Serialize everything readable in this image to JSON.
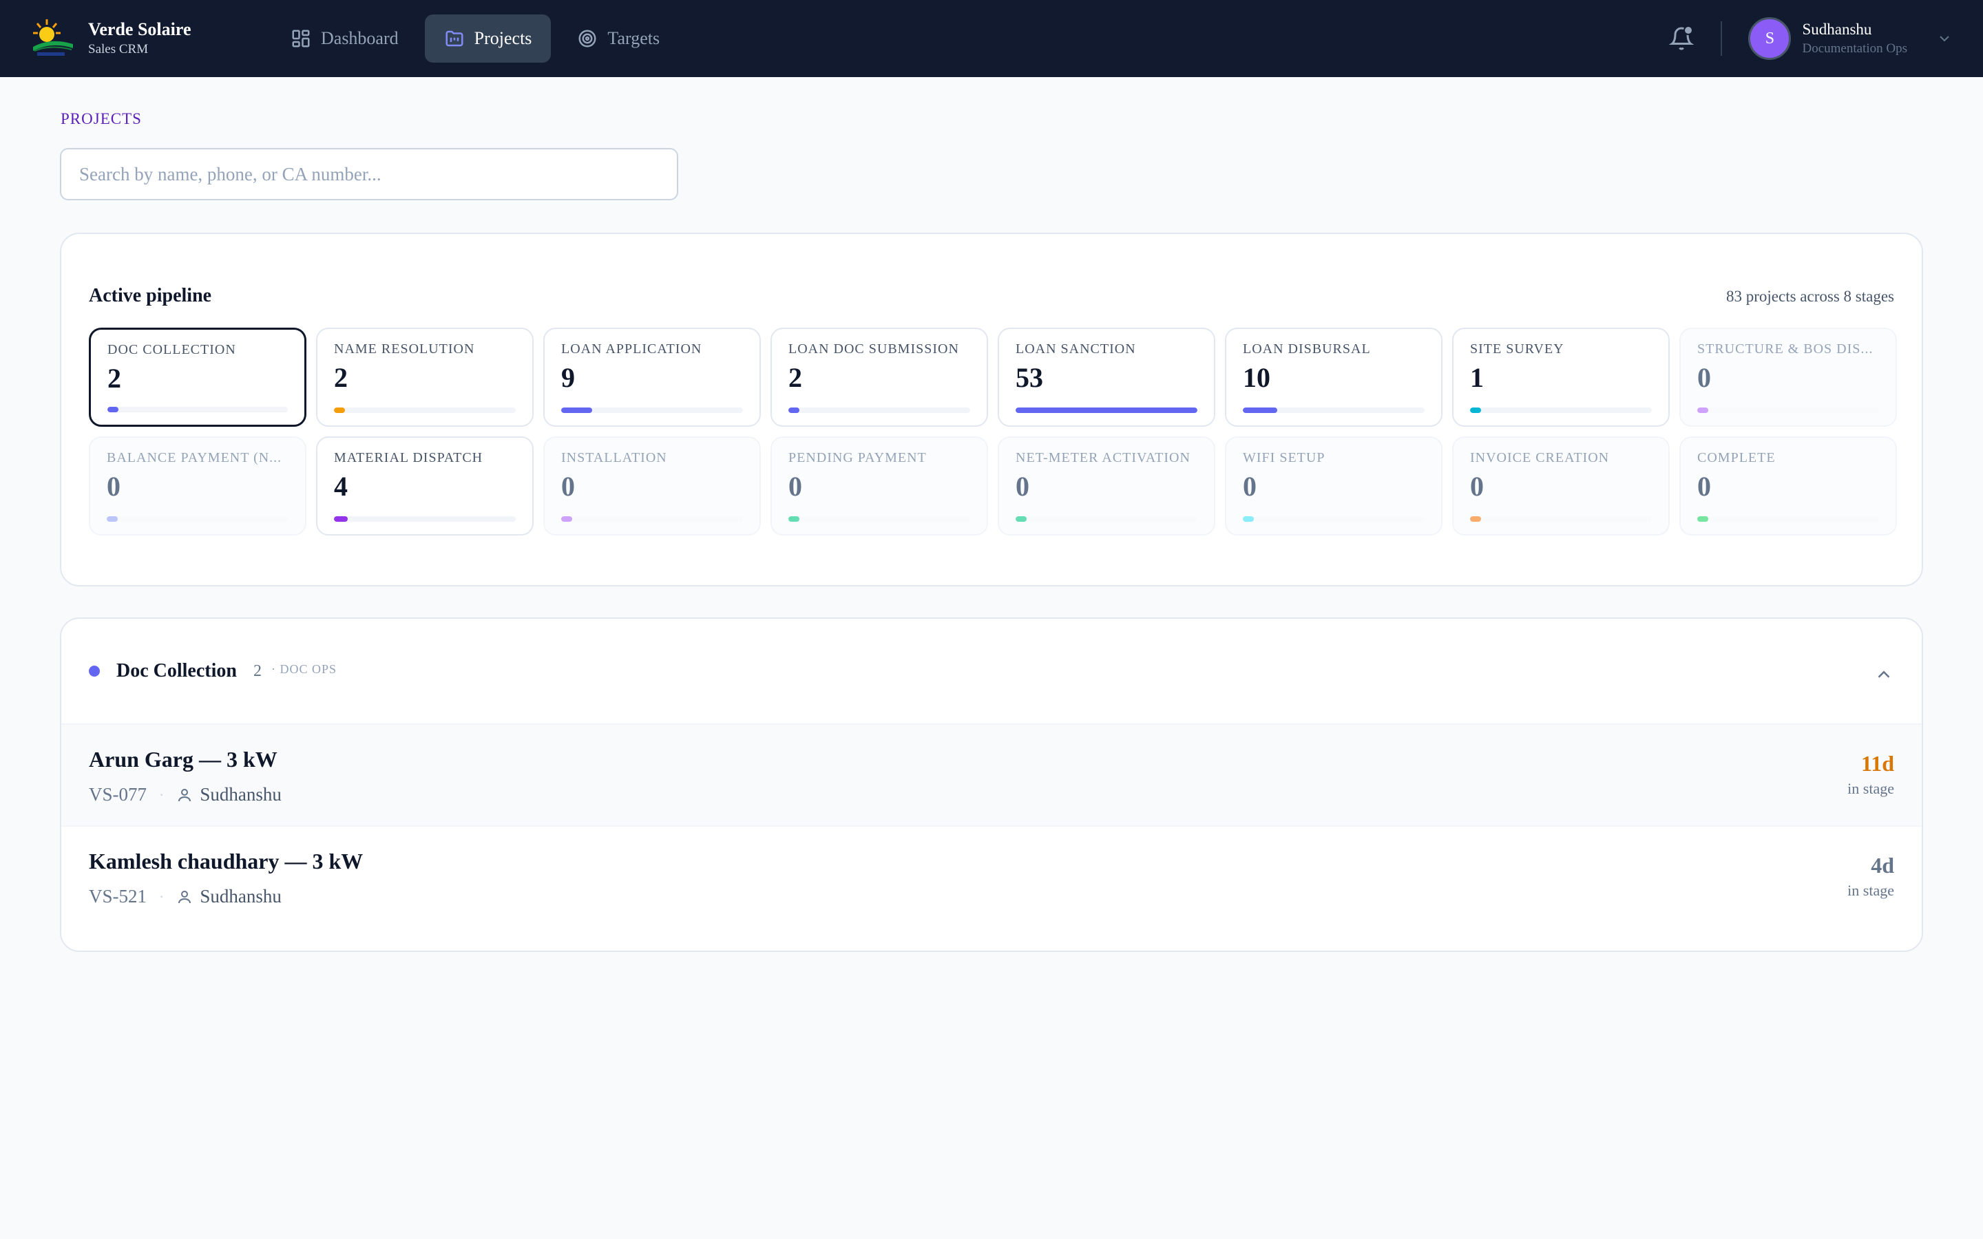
{
  "app": {
    "name": "Verde Solaire",
    "subtitle": "Sales CRM"
  },
  "nav": [
    {
      "label": "Dashboard",
      "icon": "dashboard-grid-icon",
      "active": false
    },
    {
      "label": "Projects",
      "icon": "folder-kanban-icon",
      "active": true
    },
    {
      "label": "Targets",
      "icon": "target-icon",
      "active": false
    }
  ],
  "user": {
    "name": "Sudhanshu",
    "role": "Documentation Ops",
    "initial": "S",
    "avatar_color": "#8b5cf6"
  },
  "page": {
    "label": "PROJECTS"
  },
  "search": {
    "placeholder": "Search by name, phone, or CA number...",
    "value": ""
  },
  "pipeline": {
    "title": "Active pipeline",
    "summary": "83 projects across 8 stages",
    "max_count": 53,
    "stages": [
      {
        "label": "DOC COLLECTION",
        "count": 2,
        "color": "#6366f1",
        "selected": true
      },
      {
        "label": "NAME RESOLUTION",
        "count": 2,
        "color": "#f59e0b",
        "selected": false
      },
      {
        "label": "LOAN APPLICATION",
        "count": 9,
        "color": "#6366f1",
        "selected": false
      },
      {
        "label": "LOAN DOC SUBMISSION",
        "count": 2,
        "color": "#6366f1",
        "selected": false
      },
      {
        "label": "LOAN SANCTION",
        "count": 53,
        "color": "#6366f1",
        "selected": false
      },
      {
        "label": "LOAN DISBURSAL",
        "count": 10,
        "color": "#6366f1",
        "selected": false
      },
      {
        "label": "SITE SURVEY",
        "count": 1,
        "color": "#06b6d4",
        "selected": false
      },
      {
        "label": "STRUCTURE & BOS DIS...",
        "count": 0,
        "color": "#c084fc",
        "selected": false
      },
      {
        "label": "BALANCE PAYMENT (N...",
        "count": 0,
        "color": "#a5b4fc",
        "selected": false
      },
      {
        "label": "MATERIAL DISPATCH",
        "count": 4,
        "color": "#9333ea",
        "selected": false
      },
      {
        "label": "INSTALLATION",
        "count": 0,
        "color": "#c084fc",
        "selected": false
      },
      {
        "label": "PENDING PAYMENT",
        "count": 0,
        "color": "#34d399",
        "selected": false
      },
      {
        "label": "NET-METER ACTIVATION",
        "count": 0,
        "color": "#34d399",
        "selected": false
      },
      {
        "label": "WIFI SETUP",
        "count": 0,
        "color": "#67e8f9",
        "selected": false
      },
      {
        "label": "INVOICE CREATION",
        "count": 0,
        "color": "#fb923c",
        "selected": false
      },
      {
        "label": "COMPLETE",
        "count": 0,
        "color": "#4ade80",
        "selected": false
      }
    ]
  },
  "group": {
    "title": "Doc Collection",
    "count": "2",
    "tag": "· DOC OPS",
    "dot_color": "#6366f1",
    "rows": [
      {
        "title": "Arun Garg — 3 kW",
        "id": "VS-077",
        "owner": "Sudhanshu",
        "days": "11d",
        "days_label": "in stage",
        "status": "warn"
      },
      {
        "title": "Kamlesh chaudhary — 3 kW",
        "id": "VS-521",
        "owner": "Sudhanshu",
        "days": "4d",
        "days_label": "in stage",
        "status": "ok"
      }
    ]
  }
}
